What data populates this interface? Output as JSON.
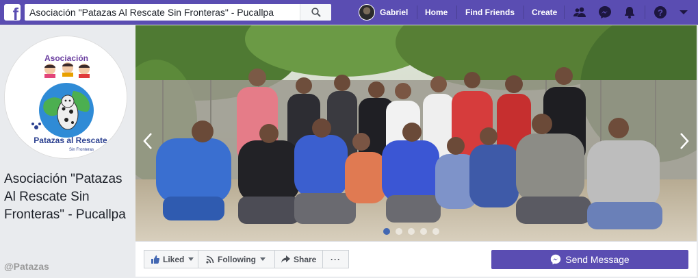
{
  "search": {
    "query": "Asociación \"Patazas Al Rescate Sin Fronteras\" - Pucallpa"
  },
  "nav": {
    "user_name": "Gabriel",
    "home_label": "Home",
    "find_friends_label": "Find Friends",
    "create_label": "Create"
  },
  "page": {
    "name": "Asociación \"Patazas Al Rescate Sin Fronteras\" - Pucallpa",
    "handle": "@Patazas",
    "logo_text_top": "Asociación",
    "logo_text_main": "Patazas al Rescate",
    "logo_text_sub": "Sin Fronteras"
  },
  "cover": {
    "slide_count": 5,
    "active_slide": 1
  },
  "actions": {
    "liked_label": "Liked",
    "following_label": "Following",
    "share_label": "Share",
    "more_label": "···",
    "send_message_label": "Send Message"
  },
  "colors": {
    "brand": "#5a4db2",
    "dot_active": "#4267b2"
  },
  "icons": [
    "facebook-logo-icon",
    "search-icon",
    "friends-icon",
    "messenger-icon",
    "bell-icon",
    "help-icon",
    "chevron-down-icon",
    "thumbs-up-icon",
    "rss-icon",
    "share-icon",
    "chevron-left-icon",
    "chevron-right-icon"
  ]
}
